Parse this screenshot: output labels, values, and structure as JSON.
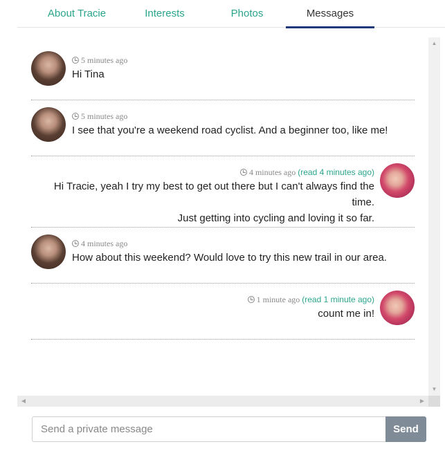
{
  "tabs": [
    {
      "label": "About Tracie"
    },
    {
      "label": "Interests"
    },
    {
      "label": "Photos"
    },
    {
      "label": "Messages"
    }
  ],
  "messages": [
    {
      "time": "5 minutes ago",
      "text": "Hi Tina",
      "read": ""
    },
    {
      "time": "5 minutes ago",
      "text": "I see that you're a weekend road cyclist. And a beginner too, like me!",
      "read": ""
    },
    {
      "time": "4 minutes ago",
      "read": "(read 4 minutes ago)",
      "text_line1": "Hi Tracie, yeah I try my best to get out there but I can't always find the time.",
      "text_line2": "Just getting into cycling and loving it so far."
    },
    {
      "time": "4 minutes ago",
      "text": "How about this weekend? Would love to try this new trail in our area.",
      "read": ""
    },
    {
      "time": "1 minute ago",
      "read": "(read 1 minute ago)",
      "text": "count me in!"
    }
  ],
  "composer": {
    "placeholder": "Send a private message",
    "send_label": "Send"
  },
  "icons": {
    "clock": "clock-icon",
    "scroll_up": "scroll-up-arrow",
    "scroll_down": "scroll-down-arrow",
    "scroll_left": "scroll-left-arrow",
    "scroll_right": "scroll-right-arrow"
  },
  "colors": {
    "accent": "#2aa58b",
    "active_tab_underline": "#1d3a7a",
    "send_button": "#7f8c97"
  }
}
